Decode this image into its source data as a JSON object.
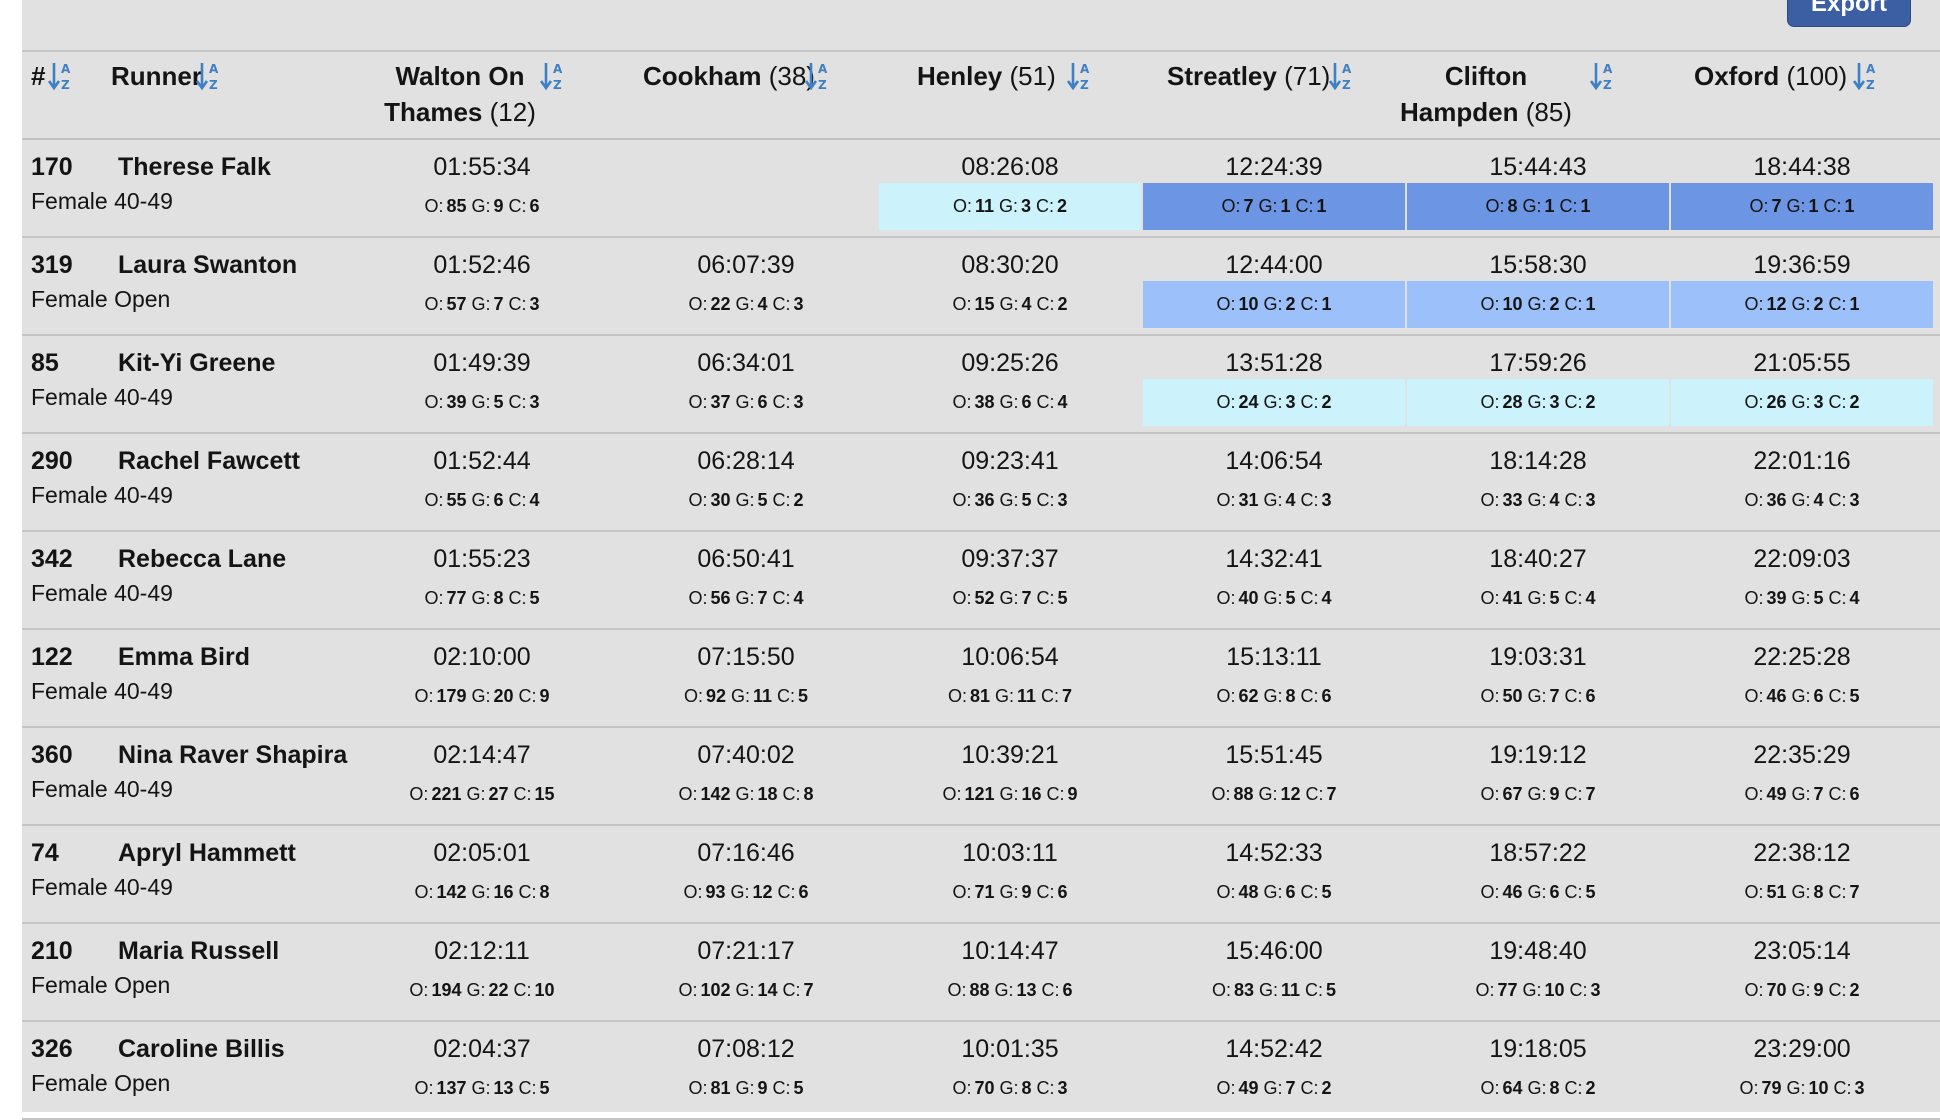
{
  "toolbar": {
    "export_label": "Export"
  },
  "colors": {
    "rank_1": "#6c95e3",
    "rank_2": "#9cc0fa",
    "rank_3": "#ccf2fc"
  },
  "columns": {
    "bib": "#",
    "runner": "Runner",
    "checkpoints": [
      {
        "line1": "Walton On",
        "line2": "Thames",
        "cp": "(12)"
      },
      {
        "line1": "Cookham",
        "line2": "",
        "cp": "(38)"
      },
      {
        "line1": "Henley",
        "line2": "",
        "cp": "(51)"
      },
      {
        "line1": "Streatley",
        "line2": "",
        "cp": "(71)"
      },
      {
        "line1": "Clifton",
        "line2": "Hampden",
        "cp": "(85)"
      },
      {
        "line1": "Oxford",
        "line2": "",
        "cp": "(100)"
      }
    ]
  },
  "rows": [
    {
      "bib": "170",
      "name": "Therese Falk",
      "category": "Female 40-49",
      "splits": [
        {
          "time": "01:55:34",
          "o": "85",
          "g": "9",
          "c": "6",
          "hl": ""
        },
        {
          "time": "",
          "o": "",
          "g": "",
          "c": "",
          "hl": ""
        },
        {
          "time": "08:26:08",
          "o": "11",
          "g": "3",
          "c": "2",
          "hl": "rank_3"
        },
        {
          "time": "12:24:39",
          "o": "7",
          "g": "1",
          "c": "1",
          "hl": "rank_1"
        },
        {
          "time": "15:44:43",
          "o": "8",
          "g": "1",
          "c": "1",
          "hl": "rank_1"
        },
        {
          "time": "18:44:38",
          "o": "7",
          "g": "1",
          "c": "1",
          "hl": "rank_1"
        }
      ]
    },
    {
      "bib": "319",
      "name": "Laura Swanton",
      "category": "Female Open",
      "splits": [
        {
          "time": "01:52:46",
          "o": "57",
          "g": "7",
          "c": "3",
          "hl": ""
        },
        {
          "time": "06:07:39",
          "o": "22",
          "g": "4",
          "c": "3",
          "hl": ""
        },
        {
          "time": "08:30:20",
          "o": "15",
          "g": "4",
          "c": "2",
          "hl": ""
        },
        {
          "time": "12:44:00",
          "o": "10",
          "g": "2",
          "c": "1",
          "hl": "rank_2"
        },
        {
          "time": "15:58:30",
          "o": "10",
          "g": "2",
          "c": "1",
          "hl": "rank_2"
        },
        {
          "time": "19:36:59",
          "o": "12",
          "g": "2",
          "c": "1",
          "hl": "rank_2"
        }
      ]
    },
    {
      "bib": "85",
      "name": "Kit-Yi Greene",
      "category": "Female 40-49",
      "splits": [
        {
          "time": "01:49:39",
          "o": "39",
          "g": "5",
          "c": "3",
          "hl": ""
        },
        {
          "time": "06:34:01",
          "o": "37",
          "g": "6",
          "c": "3",
          "hl": ""
        },
        {
          "time": "09:25:26",
          "o": "38",
          "g": "6",
          "c": "4",
          "hl": ""
        },
        {
          "time": "13:51:28",
          "o": "24",
          "g": "3",
          "c": "2",
          "hl": "rank_3"
        },
        {
          "time": "17:59:26",
          "o": "28",
          "g": "3",
          "c": "2",
          "hl": "rank_3"
        },
        {
          "time": "21:05:55",
          "o": "26",
          "g": "3",
          "c": "2",
          "hl": "rank_3"
        }
      ]
    },
    {
      "bib": "290",
      "name": "Rachel Fawcett",
      "category": "Female 40-49",
      "splits": [
        {
          "time": "01:52:44",
          "o": "55",
          "g": "6",
          "c": "4",
          "hl": ""
        },
        {
          "time": "06:28:14",
          "o": "30",
          "g": "5",
          "c": "2",
          "hl": ""
        },
        {
          "time": "09:23:41",
          "o": "36",
          "g": "5",
          "c": "3",
          "hl": ""
        },
        {
          "time": "14:06:54",
          "o": "31",
          "g": "4",
          "c": "3",
          "hl": ""
        },
        {
          "time": "18:14:28",
          "o": "33",
          "g": "4",
          "c": "3",
          "hl": ""
        },
        {
          "time": "22:01:16",
          "o": "36",
          "g": "4",
          "c": "3",
          "hl": ""
        }
      ]
    },
    {
      "bib": "342",
      "name": "Rebecca Lane",
      "category": "Female 40-49",
      "splits": [
        {
          "time": "01:55:23",
          "o": "77",
          "g": "8",
          "c": "5",
          "hl": ""
        },
        {
          "time": "06:50:41",
          "o": "56",
          "g": "7",
          "c": "4",
          "hl": ""
        },
        {
          "time": "09:37:37",
          "o": "52",
          "g": "7",
          "c": "5",
          "hl": ""
        },
        {
          "time": "14:32:41",
          "o": "40",
          "g": "5",
          "c": "4",
          "hl": ""
        },
        {
          "time": "18:40:27",
          "o": "41",
          "g": "5",
          "c": "4",
          "hl": ""
        },
        {
          "time": "22:09:03",
          "o": "39",
          "g": "5",
          "c": "4",
          "hl": ""
        }
      ]
    },
    {
      "bib": "122",
      "name": "Emma Bird",
      "category": "Female 40-49",
      "splits": [
        {
          "time": "02:10:00",
          "o": "179",
          "g": "20",
          "c": "9",
          "hl": ""
        },
        {
          "time": "07:15:50",
          "o": "92",
          "g": "11",
          "c": "5",
          "hl": ""
        },
        {
          "time": "10:06:54",
          "o": "81",
          "g": "11",
          "c": "7",
          "hl": ""
        },
        {
          "time": "15:13:11",
          "o": "62",
          "g": "8",
          "c": "6",
          "hl": ""
        },
        {
          "time": "19:03:31",
          "o": "50",
          "g": "7",
          "c": "6",
          "hl": ""
        },
        {
          "time": "22:25:28",
          "o": "46",
          "g": "6",
          "c": "5",
          "hl": ""
        }
      ]
    },
    {
      "bib": "360",
      "name": "Nina Raver Shapira",
      "category": "Female 40-49",
      "splits": [
        {
          "time": "02:14:47",
          "o": "221",
          "g": "27",
          "c": "15",
          "hl": ""
        },
        {
          "time": "07:40:02",
          "o": "142",
          "g": "18",
          "c": "8",
          "hl": ""
        },
        {
          "time": "10:39:21",
          "o": "121",
          "g": "16",
          "c": "9",
          "hl": ""
        },
        {
          "time": "15:51:45",
          "o": "88",
          "g": "12",
          "c": "7",
          "hl": ""
        },
        {
          "time": "19:19:12",
          "o": "67",
          "g": "9",
          "c": "7",
          "hl": ""
        },
        {
          "time": "22:35:29",
          "o": "49",
          "g": "7",
          "c": "6",
          "hl": ""
        }
      ]
    },
    {
      "bib": "74",
      "name": "Apryl Hammett",
      "category": "Female 40-49",
      "splits": [
        {
          "time": "02:05:01",
          "o": "142",
          "g": "16",
          "c": "8",
          "hl": ""
        },
        {
          "time": "07:16:46",
          "o": "93",
          "g": "12",
          "c": "6",
          "hl": ""
        },
        {
          "time": "10:03:11",
          "o": "71",
          "g": "9",
          "c": "6",
          "hl": ""
        },
        {
          "time": "14:52:33",
          "o": "48",
          "g": "6",
          "c": "5",
          "hl": ""
        },
        {
          "time": "18:57:22",
          "o": "46",
          "g": "6",
          "c": "5",
          "hl": ""
        },
        {
          "time": "22:38:12",
          "o": "51",
          "g": "8",
          "c": "7",
          "hl": ""
        }
      ]
    },
    {
      "bib": "210",
      "name": "Maria Russell",
      "category": "Female Open",
      "splits": [
        {
          "time": "02:12:11",
          "o": "194",
          "g": "22",
          "c": "10",
          "hl": ""
        },
        {
          "time": "07:21:17",
          "o": "102",
          "g": "14",
          "c": "7",
          "hl": ""
        },
        {
          "time": "10:14:47",
          "o": "88",
          "g": "13",
          "c": "6",
          "hl": ""
        },
        {
          "time": "15:46:00",
          "o": "83",
          "g": "11",
          "c": "5",
          "hl": ""
        },
        {
          "time": "19:48:40",
          "o": "77",
          "g": "10",
          "c": "3",
          "hl": ""
        },
        {
          "time": "23:05:14",
          "o": "70",
          "g": "9",
          "c": "2",
          "hl": ""
        }
      ]
    },
    {
      "bib": "326",
      "name": "Caroline Billis",
      "category": "Female Open",
      "splits": [
        {
          "time": "02:04:37",
          "o": "137",
          "g": "13",
          "c": "5",
          "hl": ""
        },
        {
          "time": "07:08:12",
          "o": "81",
          "g": "9",
          "c": "5",
          "hl": ""
        },
        {
          "time": "10:01:35",
          "o": "70",
          "g": "8",
          "c": "3",
          "hl": ""
        },
        {
          "time": "14:52:42",
          "o": "49",
          "g": "7",
          "c": "2",
          "hl": ""
        },
        {
          "time": "19:18:05",
          "o": "64",
          "g": "8",
          "c": "2",
          "hl": ""
        },
        {
          "time": "23:29:00",
          "o": "79",
          "g": "10",
          "c": "3",
          "hl": ""
        }
      ]
    }
  ]
}
